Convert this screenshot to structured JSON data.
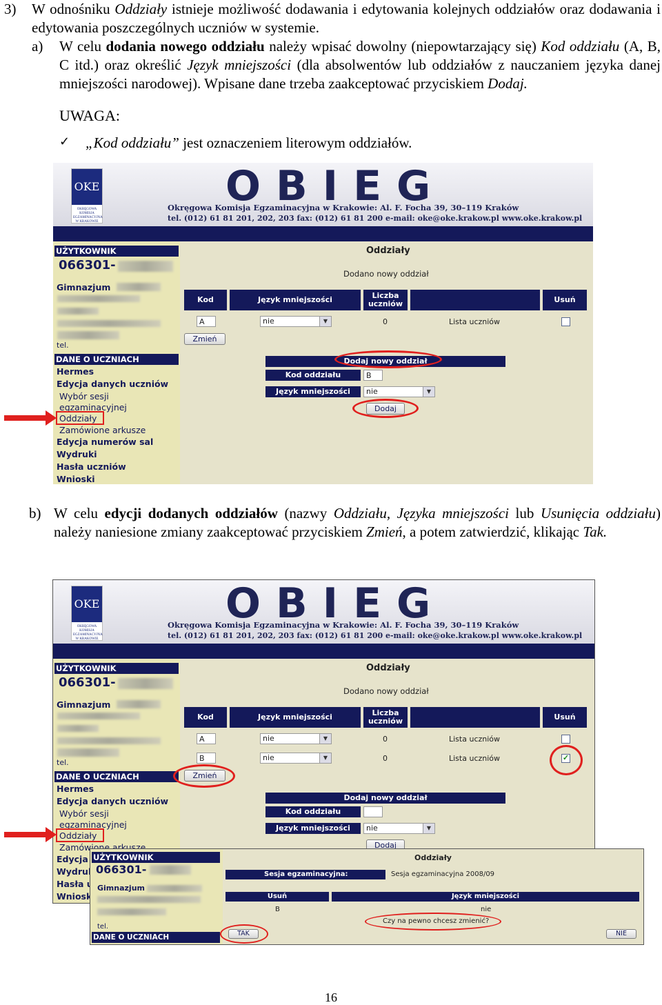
{
  "doc": {
    "item3_num": "3)",
    "item3_pre": "W odnośniku",
    "item3_link": "Oddziały",
    "item3_post": "istnieje możliwość dodawania i edytowania kolejnych oddziałów oraz dodawania i edytowania poszczególnych uczniów w systemie.",
    "a_label": "a)",
    "a_t1": "W celu",
    "a_b1": "dodania nowego oddziału",
    "a_t2": "należy wpisać dowolny (niepowtarzający się)",
    "a_i1": "Kod oddziału",
    "a_t3": "(A, B, C itd.) oraz określić",
    "a_i2": "Język mniejszości",
    "a_t4": "(dla absolwentów lub oddziałów z nauczaniem języka danej mniejszości narodowej). Wpisane dane trzeba zaakceptować przyciskiem",
    "a_i3": "Dodaj.",
    "uwaga": "UWAGA:",
    "uwaga_quote": "„Kod oddziału”",
    "uwaga_text": "jest oznaczeniem literowym oddziałów.",
    "b_label": "b)",
    "b_t1": "W celu",
    "b_b1": "edycji dodanych oddziałów",
    "b_t2": "(nazwy",
    "b_i1": "Oddziału, Języka mniejszości",
    "b_t3": "lub",
    "b_i2": "Usunięcia oddziału",
    "b_t4": ") należy naniesione zmiany zaakceptować przyciskiem",
    "b_i3": "Zmień",
    "b_t5": ", a potem zatwierdzić, klikając",
    "b_i4": "Tak.",
    "page_number": "16"
  },
  "app": {
    "brand": "OBIEG",
    "logo_mark": "OKE",
    "logo_caption": "OKRĘGOWA KOMISJA EGZAMINACYJNA W KRAKOWIE",
    "address1": "Okręgowa Komisja Egzaminacyjna w Krakowie: Al. F. Focha 39, 30–119 Kraków",
    "address2": "tel. (012) 61 81 201, 202, 203  fax: (012) 61 81 200  e-mail: oke@oke.krakow.pl   www.oke.krakow.pl",
    "sidebar": {
      "user_header": "UŻYTKOWNIK",
      "user_id": "066301-",
      "school": "Gimnazjum",
      "tel": "tel.",
      "data_header": "DANE O UCZNIACH",
      "items": [
        "Hermes",
        "Edycja danych uczniów",
        "Wybór sesji",
        "egzaminacyjnej",
        "Oddziały",
        "Zamówione arkusze",
        "Edycja numerów sal",
        "Wydruki",
        "Hasła uczniów",
        "Wnioski"
      ]
    },
    "page_title": "Oddziały",
    "message": "Dodano nowy oddział",
    "table_headers": {
      "kod": "Kod",
      "jezyk": "Język mniejszości",
      "liczba": "Liczba uczniów",
      "usun": "Usuń"
    },
    "rows_a": [
      {
        "kod": "A",
        "jezyk": "nie",
        "liczba": "0",
        "lista": "Lista uczniów"
      }
    ],
    "rows_b": [
      {
        "kod": "A",
        "jezyk": "nie",
        "liczba": "0",
        "lista": "Lista uczniów"
      },
      {
        "kod": "B",
        "jezyk": "nie",
        "liczba": "0",
        "lista": "Lista uczniów"
      }
    ],
    "checkbox_checked": "✓",
    "change_button": "Zmień",
    "add_header": "Dodaj nowy oddział",
    "add_kod_label": "Kod oddziału",
    "add_kod_value_a": "B",
    "add_kod_value_b": "",
    "add_lang_label": "Język mniejszości",
    "add_lang_value": "nie",
    "add_button": "Dodaj",
    "popup": {
      "user_header": "UŻYTKOWNIK",
      "user_id": "066301-",
      "school": "Gimnazjum",
      "tel": "tel.",
      "data_header": "DANE O UCZNIACH",
      "title": "Oddziały",
      "session_label": "Sesja egzaminacyjna:",
      "session_value": "Sesja egzaminacyjna 2008/09",
      "col_usun": "Usuń",
      "col_jezyk": "Język mniejszości",
      "val_usun": "B",
      "val_jezyk": "nie",
      "question": "Czy na pewno chcesz zmienić?",
      "yes": "TAK",
      "no": "NIE"
    }
  },
  "colors": {
    "navy": "#14195a",
    "sidebar": "#e9e6b6",
    "highlight": "#e0201e"
  }
}
